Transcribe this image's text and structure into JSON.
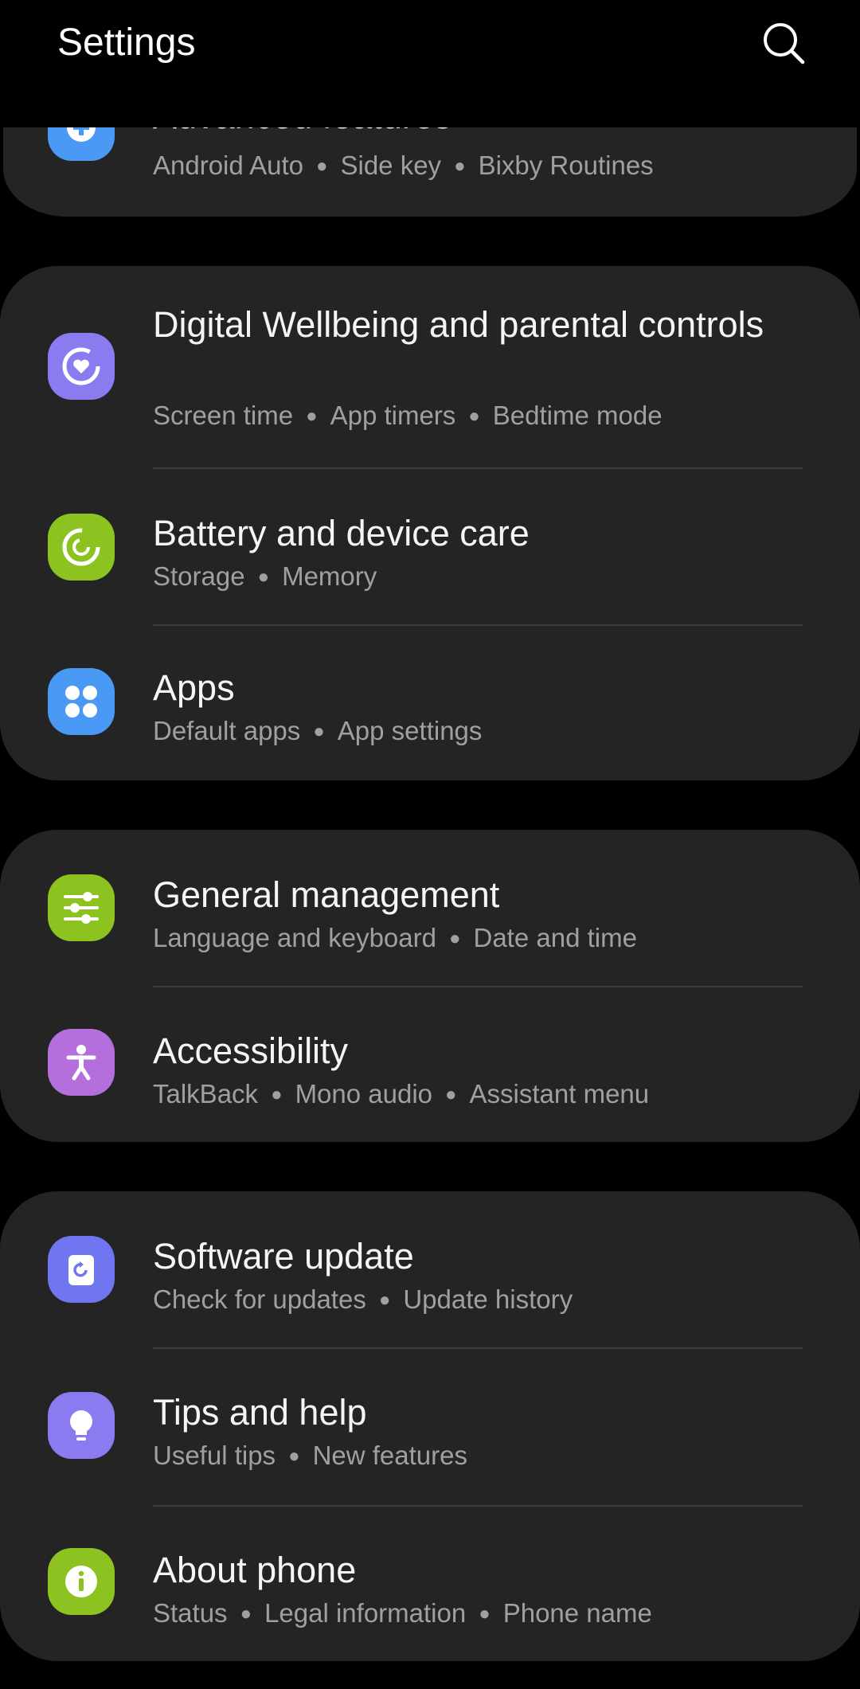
{
  "header": {
    "title": "Settings"
  },
  "icons": {
    "search": "search-icon"
  },
  "colors": {
    "background": "#000000",
    "card": "#242424",
    "blue": "#4a9af5",
    "purple": "#8a7cf0",
    "green": "#8cc320",
    "pink": "#b46fdc",
    "indigo": "#6f76f0"
  },
  "groups": [
    {
      "items": [
        {
          "title": "Advanced features",
          "subtitles": [
            "Android Auto",
            "Side key",
            "Bixby Routines"
          ],
          "icon": "gear-plus-icon",
          "color": "#4a9af5"
        }
      ]
    },
    {
      "items": [
        {
          "title": "Digital Wellbeing and parental controls",
          "subtitles": [
            "Screen time",
            "App timers",
            "Bedtime mode"
          ],
          "icon": "wellbeing-heart-icon",
          "color": "#8a7cf0"
        },
        {
          "title": "Battery and device care",
          "subtitles": [
            "Storage",
            "Memory"
          ],
          "icon": "device-care-icon",
          "color": "#8cc320"
        },
        {
          "title": "Apps",
          "subtitles": [
            "Default apps",
            "App settings"
          ],
          "icon": "apps-grid-icon",
          "color": "#4a9af5"
        }
      ]
    },
    {
      "items": [
        {
          "title": "General management",
          "subtitles": [
            "Language and keyboard",
            "Date and time"
          ],
          "icon": "sliders-icon",
          "color": "#8cc320"
        },
        {
          "title": "Accessibility",
          "subtitles": [
            "TalkBack",
            "Mono audio",
            "Assistant menu"
          ],
          "icon": "accessibility-person-icon",
          "color": "#b46fdc"
        }
      ]
    },
    {
      "items": [
        {
          "title": "Software update",
          "subtitles": [
            "Check for updates",
            "Update history"
          ],
          "icon": "software-update-icon",
          "color": "#6f76f0"
        },
        {
          "title": "Tips and help",
          "subtitles": [
            "Useful tips",
            "New features"
          ],
          "icon": "lightbulb-icon",
          "color": "#8a7cf0"
        },
        {
          "title": "About phone",
          "subtitles": [
            "Status",
            "Legal information",
            "Phone name"
          ],
          "icon": "info-icon",
          "color": "#8cc320"
        }
      ]
    }
  ]
}
